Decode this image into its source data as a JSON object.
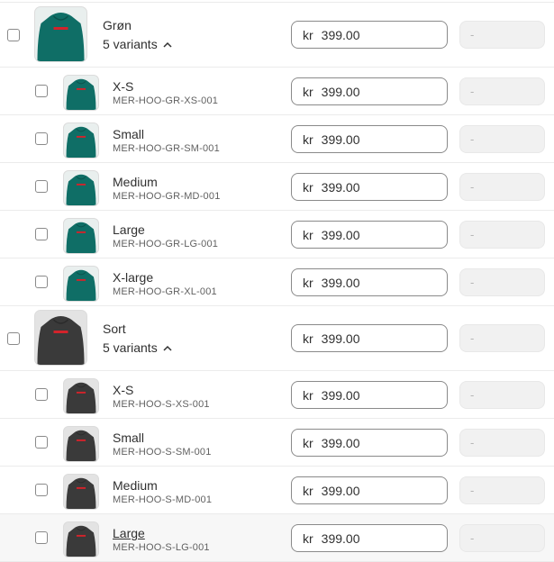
{
  "colors": {
    "green": "#0f6e66",
    "black": "#3a3a3a",
    "print": "#d3232b"
  },
  "groups": [
    {
      "name": "Grøn",
      "variants_label": "5 variants",
      "price_currency": "kr",
      "price": "399.00",
      "compare_at": "-",
      "color": "green",
      "variants": [
        {
          "size": "X-S",
          "sku": "MER-HOO-GR-XS-001",
          "currency": "kr",
          "price": "399.00",
          "compare_at": "-"
        },
        {
          "size": "Small",
          "sku": "MER-HOO-GR-SM-001",
          "currency": "kr",
          "price": "399.00",
          "compare_at": "-"
        },
        {
          "size": "Medium",
          "sku": "MER-HOO-GR-MD-001",
          "currency": "kr",
          "price": "399.00",
          "compare_at": "-"
        },
        {
          "size": "Large",
          "sku": "MER-HOO-GR-LG-001",
          "currency": "kr",
          "price": "399.00",
          "compare_at": "-"
        },
        {
          "size": "X-large",
          "sku": "MER-HOO-GR-XL-001",
          "currency": "kr",
          "price": "399.00",
          "compare_at": "-"
        }
      ]
    },
    {
      "name": "Sort",
      "variants_label": "5 variants",
      "price_currency": "kr",
      "price": "399.00",
      "compare_at": "-",
      "color": "black",
      "variants": [
        {
          "size": "X-S",
          "sku": "MER-HOO-S-XS-001",
          "currency": "kr",
          "price": "399.00",
          "compare_at": "-"
        },
        {
          "size": "Small",
          "sku": "MER-HOO-S-SM-001",
          "currency": "kr",
          "price": "399.00",
          "compare_at": "-"
        },
        {
          "size": "Medium",
          "sku": "MER-HOO-S-MD-001",
          "currency": "kr",
          "price": "399.00",
          "compare_at": "-"
        },
        {
          "size": "Large",
          "sku": "MER-HOO-S-LG-001",
          "currency": "kr",
          "price": "399.00",
          "compare_at": "-"
        }
      ]
    }
  ]
}
